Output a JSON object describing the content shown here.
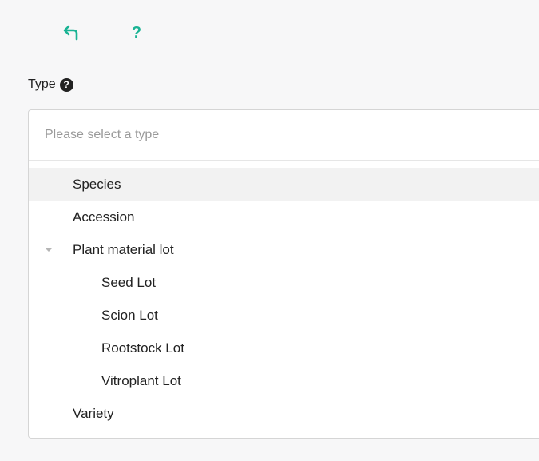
{
  "toolbar": {
    "back_icon": "undo-arrow-icon",
    "help_label": "?"
  },
  "field": {
    "label": "Type",
    "help_badge": "?",
    "placeholder": "Please select a type"
  },
  "options": [
    {
      "label": "Species",
      "level": 1,
      "highlighted": true
    },
    {
      "label": "Accession",
      "level": 1
    },
    {
      "label": "Plant material lot",
      "level": 1,
      "expanded": true
    },
    {
      "label": "Seed Lot",
      "level": 2
    },
    {
      "label": "Scion Lot",
      "level": 2
    },
    {
      "label": "Rootstock Lot",
      "level": 2
    },
    {
      "label": "Vitroplant Lot",
      "level": 2
    },
    {
      "label": "Variety",
      "level": 1
    }
  ],
  "colors": {
    "accent": "#1ab394",
    "highlight": "#f2f2f2",
    "placeholder": "#9a9a9a"
  }
}
